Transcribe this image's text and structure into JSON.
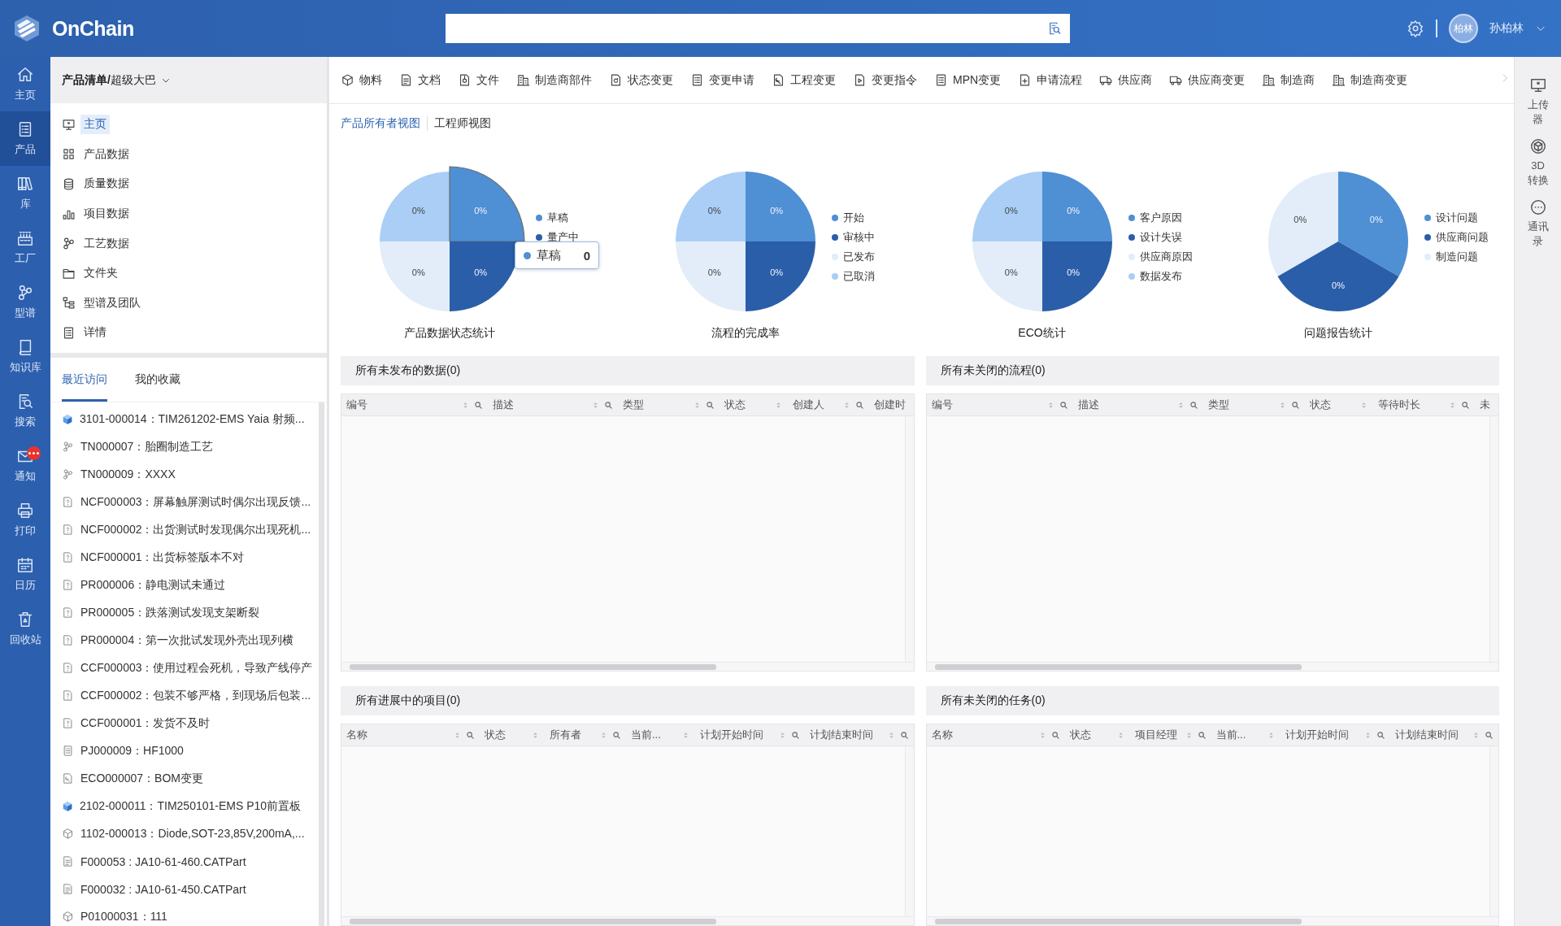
{
  "app": {
    "name": "OnChain",
    "user": {
      "avatar": "柏林",
      "name": "孙柏林"
    }
  },
  "nav": [
    {
      "label": "主页",
      "selected": false,
      "badge": false
    },
    {
      "label": "产品",
      "selected": true,
      "badge": false
    },
    {
      "label": "库",
      "selected": false,
      "badge": false
    },
    {
      "label": "工厂",
      "selected": false,
      "badge": false
    },
    {
      "label": "型谱",
      "selected": false,
      "badge": false
    },
    {
      "label": "知识库",
      "selected": false,
      "badge": false
    },
    {
      "label": "搜索",
      "selected": false,
      "badge": false
    },
    {
      "label": "通知",
      "selected": false,
      "badge": true
    },
    {
      "label": "打印",
      "selected": false,
      "badge": false
    },
    {
      "label": "日历",
      "selected": false,
      "badge": false
    },
    {
      "label": "回收站",
      "selected": false,
      "badge": false
    }
  ],
  "side_panel": {
    "breadcrumb": "**产品清单/**超级大巴",
    "menu": [
      {
        "label": "主页",
        "selected": true
      },
      {
        "label": "产品数据",
        "selected": false
      },
      {
        "label": "质量数据",
        "selected": false
      },
      {
        "label": "项目数据",
        "selected": false
      },
      {
        "label": "工艺数据",
        "selected": false
      },
      {
        "label": "文件夹",
        "selected": false
      },
      {
        "label": "型谱及团队",
        "selected": false
      },
      {
        "label": "详情",
        "selected": false
      }
    ],
    "tabs": [
      {
        "label": "最近访问",
        "selected": true
      },
      {
        "label": "我的收藏",
        "selected": false
      }
    ],
    "recent": [
      {
        "kind": "cube",
        "text": "3101-000014：TIM261202-EMS Yaia 射频..."
      },
      {
        "kind": "process",
        "text": "TN000007：胎圈制造工艺"
      },
      {
        "kind": "process",
        "text": "TN000009：XXXX"
      },
      {
        "kind": "issue",
        "text": "NCF000003：屏幕触屏测试时偶尔出现反馈..."
      },
      {
        "kind": "issue",
        "text": "NCF000002：出货测试时发现偶尔出现死机..."
      },
      {
        "kind": "issue",
        "text": "NCF000001：出货标签版本不对"
      },
      {
        "kind": "issue",
        "text": "PR000006：静电测试未通过"
      },
      {
        "kind": "issue",
        "text": "PR000005：跌落测试发现支架断裂"
      },
      {
        "kind": "issue",
        "text": "PR000004：第一次批试发现外壳出现列横"
      },
      {
        "kind": "issue",
        "text": "CCF000003：使用过程会死机，导致产线停产"
      },
      {
        "kind": "issue",
        "text": "CCF000002：包装不够严格，到现场后包装..."
      },
      {
        "kind": "issue",
        "text": "CCF000001：发货不及时"
      },
      {
        "kind": "project",
        "text": "PJ000009：HF1000"
      },
      {
        "kind": "eco",
        "text": "ECO000007：BOM变更"
      },
      {
        "kind": "cube",
        "text": "2102-000011：TIM250101-EMS P10前置板"
      },
      {
        "kind": "component",
        "text": "1102-000013：Diode,SOT-23,85V,200mA,..."
      },
      {
        "kind": "cad",
        "text": "F000053 : JA10-61-460.CATPart"
      },
      {
        "kind": "cad",
        "text": "F000032 : JA10-61-450.CATPart"
      },
      {
        "kind": "component",
        "text": "P01000031：111"
      }
    ]
  },
  "toolbar": [
    {
      "label": "物料"
    },
    {
      "label": "文档"
    },
    {
      "label": "文件"
    },
    {
      "label": "制造商部件"
    },
    {
      "label": "状态变更"
    },
    {
      "label": "变更申请"
    },
    {
      "label": "工程变更"
    },
    {
      "label": "变更指令"
    },
    {
      "label": "MPN变更"
    },
    {
      "label": "申请流程"
    },
    {
      "label": "供应商"
    },
    {
      "label": "供应商变更"
    },
    {
      "label": "制造商"
    },
    {
      "label": "制造商变更"
    }
  ],
  "views": [
    {
      "label": "产品所有者视图",
      "selected": true
    },
    {
      "label": "工程师视图",
      "selected": false
    }
  ],
  "charts": [
    {
      "title": "产品数据状态统计",
      "slices": [
        {
          "label": "0%",
          "color": "#aacef5",
          "selected": false
        },
        {
          "label": "0%",
          "color": "#4f8fd4",
          "selected": true
        },
        {
          "label": "0%",
          "color": "#e2edf9",
          "selected": false
        },
        {
          "label": "0%",
          "color": "#2a5ea9",
          "selected": false
        }
      ],
      "legend": [
        {
          "label": "草稿",
          "color": "#4f8fd4"
        },
        {
          "label": "量产中",
          "color": "#2a5ea9"
        }
      ],
      "tooltip": {
        "label": "草稿",
        "value": "0",
        "color": "#4f8fd4"
      }
    },
    {
      "title": "流程的完成率",
      "slices": [
        {
          "label": "0%",
          "color": "#aacef5",
          "selected": false
        },
        {
          "label": "0%",
          "color": "#4f8fd4",
          "selected": false
        },
        {
          "label": "0%",
          "color": "#e2edf9",
          "selected": false
        },
        {
          "label": "0%",
          "color": "#2a5ea9",
          "selected": false
        }
      ],
      "legend": [
        {
          "label": "开始",
          "color": "#4f8fd4"
        },
        {
          "label": "审核中",
          "color": "#2a5ea9"
        },
        {
          "label": "已发布",
          "color": "#e2edf9"
        },
        {
          "label": "已取消",
          "color": "#aacef5"
        }
      ]
    },
    {
      "title": "ECO统计",
      "slices": [
        {
          "label": "0%",
          "color": "#aacef5",
          "selected": false
        },
        {
          "label": "0%",
          "color": "#4f8fd4",
          "selected": false
        },
        {
          "label": "0%",
          "color": "#e2edf9",
          "selected": false
        },
        {
          "label": "0%",
          "color": "#2a5ea9",
          "selected": false
        }
      ],
      "legend": [
        {
          "label": "客户原因",
          "color": "#4f8fd4"
        },
        {
          "label": "设计失误",
          "color": "#2a5ea9"
        },
        {
          "label": "供应商原因",
          "color": "#e2edf9"
        },
        {
          "label": "数据发布",
          "color": "#aacef5"
        }
      ]
    },
    {
      "title": "问题报告统计",
      "slices": [
        {
          "label": "0%",
          "color": "#e2edf9",
          "selected": false
        },
        {
          "label": "0%",
          "color": "#4f8fd4",
          "selected": false
        },
        {
          "label": "0%",
          "color": "#2a5ea9",
          "selected": false
        }
      ],
      "legend": [
        {
          "label": "设计问题",
          "color": "#4f8fd4"
        },
        {
          "label": "供应商问题",
          "color": "#2a5ea9"
        },
        {
          "label": "制造问题",
          "color": "#e2edf9"
        }
      ]
    }
  ],
  "panels": [
    {
      "title": "所有未发布的数据(0)",
      "columns": [
        {
          "label": "编号",
          "sort": true,
          "filter": true
        },
        {
          "label": "描述",
          "sort": true,
          "filter": true
        },
        {
          "label": "类型",
          "sort": true,
          "filter": true
        },
        {
          "label": "状态",
          "sort": true,
          "filter": false
        },
        {
          "label": "创建人",
          "sort": true,
          "filter": true
        },
        {
          "label": "创建时",
          "sort": false,
          "filter": false
        }
      ]
    },
    {
      "title": "所有未关闭的流程(0)",
      "columns": [
        {
          "label": "编号",
          "sort": true,
          "filter": true
        },
        {
          "label": "描述",
          "sort": true,
          "filter": true
        },
        {
          "label": "类型",
          "sort": true,
          "filter": true
        },
        {
          "label": "状态",
          "sort": true,
          "filter": false
        },
        {
          "label": "等待时长",
          "sort": true,
          "filter": true
        },
        {
          "label": "未",
          "sort": false,
          "filter": false
        }
      ]
    },
    {
      "title": "所有进展中的项目(0)",
      "columns": [
        {
          "label": "名称",
          "sort": true,
          "filter": true
        },
        {
          "label": "状态",
          "sort": true,
          "filter": false
        },
        {
          "label": "所有者",
          "sort": true,
          "filter": true
        },
        {
          "label": "当前...",
          "sort": true,
          "filter": false
        },
        {
          "label": "计划开始时间",
          "sort": true,
          "filter": true
        },
        {
          "label": "计划结束时间",
          "sort": true,
          "filter": true
        }
      ]
    },
    {
      "title": "所有未关闭的任务(0)",
      "columns": [
        {
          "label": "名称",
          "sort": true,
          "filter": true
        },
        {
          "label": "状态",
          "sort": true,
          "filter": false
        },
        {
          "label": "项目经理",
          "sort": true,
          "filter": true
        },
        {
          "label": "当前...",
          "sort": true,
          "filter": false
        },
        {
          "label": "计划开始时间",
          "sort": true,
          "filter": true
        },
        {
          "label": "计划结束时间",
          "sort": true,
          "filter": true
        }
      ]
    }
  ],
  "right_rail": [
    {
      "label": "上传器"
    },
    {
      "label": "3D 转换"
    },
    {
      "label": "通讯录"
    }
  ]
}
